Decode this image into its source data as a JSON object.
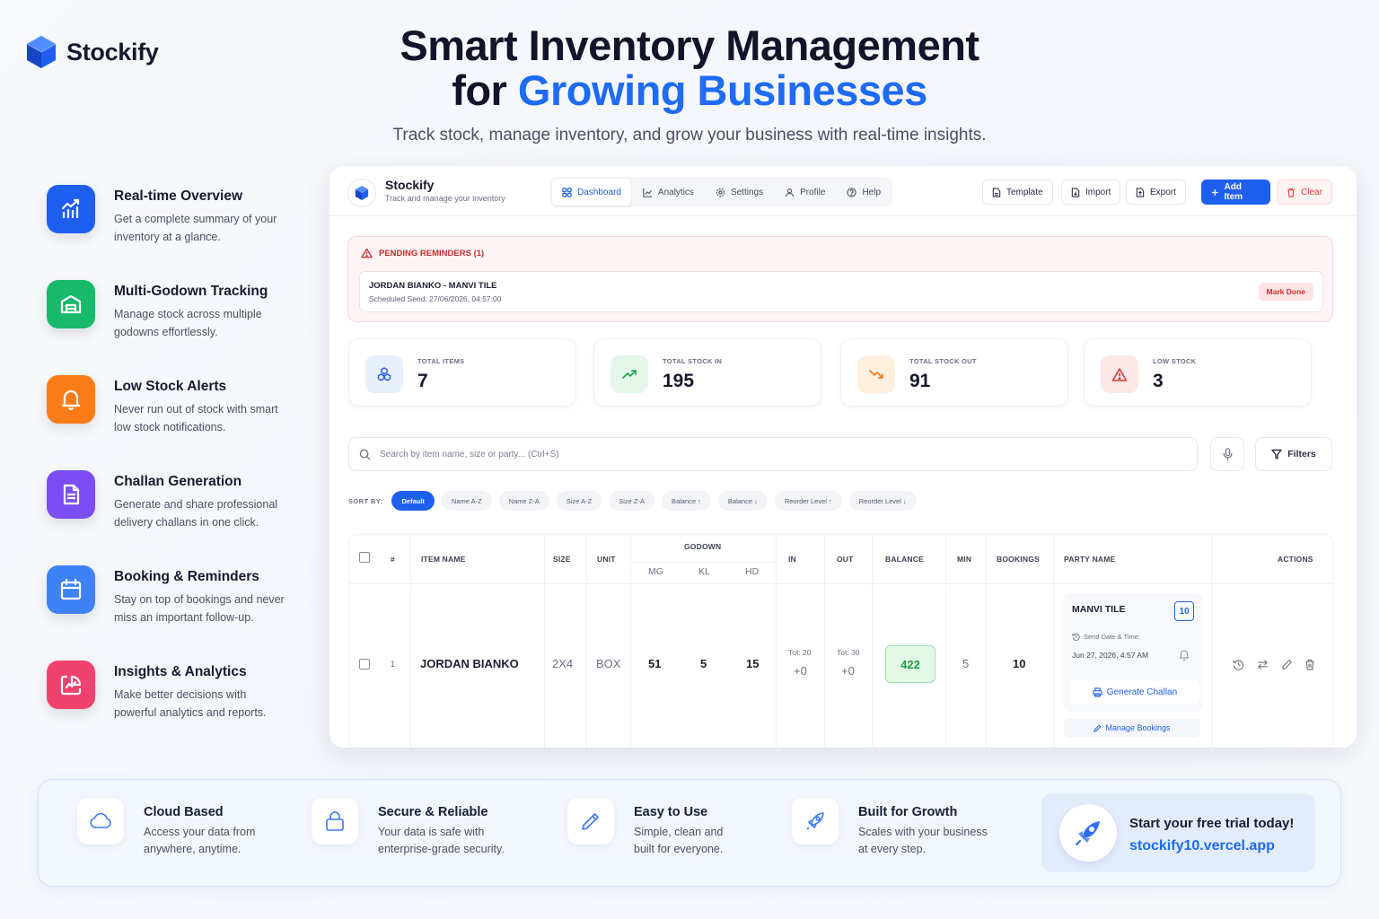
{
  "brand": {
    "name": "Stockify"
  },
  "hero": {
    "line1": "Smart Inventory Management",
    "line2_prefix": "for ",
    "line2_accent": "Growing Businesses",
    "subtitle": "Track stock, manage inventory, and grow your business with real-time insights."
  },
  "features": [
    {
      "title": "Real-time Overview",
      "desc": "Get a complete summary of your inventory at a glance.",
      "icon": "bar-chart-icon",
      "color": "#1f5ff0"
    },
    {
      "title": "Multi-Godown Tracking",
      "desc": "Manage stock across multiple godowns effortlessly.",
      "icon": "warehouse-icon",
      "color": "#18b96a"
    },
    {
      "title": "Low Stock Alerts",
      "desc": "Never run out of stock with smart low stock notifications.",
      "icon": "bell-icon",
      "color": "#fb7b17"
    },
    {
      "title": "Challan Generation",
      "desc": "Generate and share professional delivery challans in one click.",
      "icon": "document-icon",
      "color": "#7b4ef5"
    },
    {
      "title": "Booking & Reminders",
      "desc": "Stay on top of bookings and never miss an important follow-up.",
      "icon": "calendar-icon",
      "color": "#3f82f8"
    },
    {
      "title": "Insights & Analytics",
      "desc": "Make better decisions with powerful analytics and reports.",
      "icon": "analytics-icon",
      "color": "#f0426e"
    }
  ],
  "app": {
    "title": "Stockify",
    "subtitle": "Track and manage your inventory",
    "logo_label": "Stockify",
    "nav": [
      {
        "label": "Dashboard",
        "icon": "grid-icon",
        "active": true
      },
      {
        "label": "Analytics",
        "icon": "line-chart-icon"
      },
      {
        "label": "Settings",
        "icon": "gear-icon"
      },
      {
        "label": "Profile",
        "icon": "user-icon"
      },
      {
        "label": "Help",
        "icon": "help-icon"
      }
    ],
    "actions": {
      "template": "Template",
      "import": "Import",
      "export": "Export",
      "add": "Add Item",
      "clear": "Clear"
    },
    "reminders": {
      "heading": "PENDING REMINDERS (1)",
      "item_name": "JORDAN BIANKO - MANVI TILE",
      "item_date": "Scheduled Send: 27/06/2026, 04:57:00",
      "button": "Mark Done"
    },
    "stats": [
      {
        "label": "TOTAL ITEMS",
        "value": "7",
        "bg": "#e8f0fe",
        "color": "#2a62e8"
      },
      {
        "label": "TOTAL STOCK IN",
        "value": "195",
        "bg": "#e5f7ea",
        "color": "#1fa84a"
      },
      {
        "label": "TOTAL STOCK OUT",
        "value": "91",
        "bg": "#fff0e0",
        "color": "#ef7d16"
      },
      {
        "label": "LOW STOCK",
        "value": "3",
        "bg": "#fde8e8",
        "color": "#e23b3b"
      }
    ],
    "search": {
      "placeholder": "Search by item name, size or party... (Ctrl+S)",
      "value": ""
    },
    "filters_label": "Filters",
    "sort": {
      "label": "SORT BY:",
      "options": [
        "Default",
        "Name A-Z",
        "Name Z-A",
        "Size A-Z",
        "Size Z-A",
        "Balance ↑",
        "Balance ↓",
        "Reorder Level ↑",
        "Reorder Level ↓"
      ],
      "active": "Default"
    },
    "table": {
      "headers": {
        "num": "#",
        "item_name": "ITEM NAME",
        "size": "SIZE",
        "unit": "UNIT",
        "godown": "GODOWN",
        "mg": "MG",
        "kl": "KL",
        "hd": "HD",
        "in": "IN",
        "out": "OUT",
        "balance": "BALANCE",
        "min": "MIN",
        "bookings": "BOOKINGS",
        "party": "PARTY NAME",
        "actions": "ACTIONS"
      },
      "row": {
        "num": "1",
        "item_name": "JORDAN BIANKO",
        "size": "2X4",
        "unit": "BOX",
        "mg": "51",
        "kl": "5",
        "hd": "15",
        "in_total": "Tot: 20",
        "in_value": "+0",
        "out_total": "Tot: 30",
        "out_value": "+0",
        "balance": "422",
        "min": "5",
        "bookings": "10",
        "party": {
          "name": "MANVI TILE",
          "count": "10",
          "send_label": "Send Date & Time:",
          "send_value": "Jun 27, 2026, 4:57 AM",
          "generate": "Generate Challan",
          "manage": "Manage Bookings"
        }
      }
    }
  },
  "bottom": {
    "items": [
      {
        "title": "Cloud Based",
        "desc1": "Access your data from",
        "desc2": "anywhere, anytime.",
        "icon": "cloud-icon"
      },
      {
        "title": "Secure & Reliable",
        "desc1": "Your data is safe with",
        "desc2": "enterprise-grade security.",
        "icon": "lock-icon"
      },
      {
        "title": "Easy to Use",
        "desc1": "Simple, clean and",
        "desc2": "built for everyone.",
        "icon": "pencil-icon"
      },
      {
        "title": "Built for Growth",
        "desc1": "Scales with your business",
        "desc2": "at every step.",
        "icon": "rocket-icon"
      }
    ],
    "cta": {
      "title": "Start your free trial today!",
      "link": "stockify10.vercel.app",
      "icon": "rocket-icon"
    }
  },
  "colors": {
    "primary": "#1f5ff0",
    "accent_text": "#1e6bf5",
    "danger": "#e23b3b",
    "success": "#15a03a"
  }
}
